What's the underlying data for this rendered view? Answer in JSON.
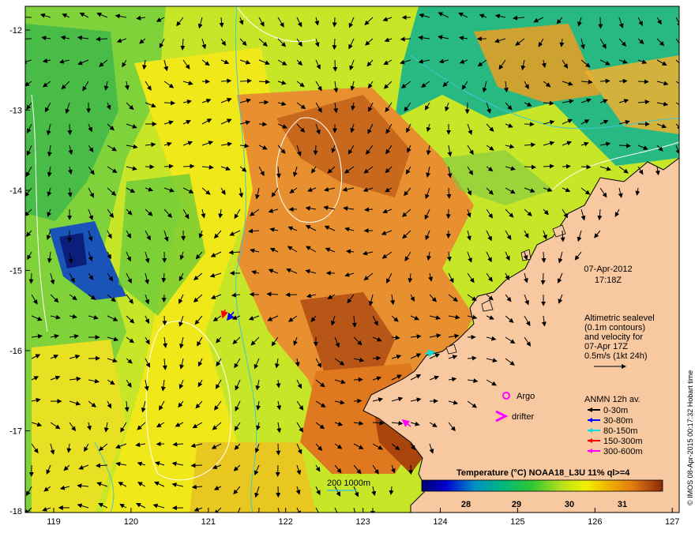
{
  "date_line": "07-Apr-2012",
  "time_line": "17:18Z",
  "altimetry_notes": [
    "Altimetric sealevel",
    "(0.1m contours)",
    "and velocity for",
    "07-Apr 17Z",
    "0.5m/s (1kt 24h)"
  ],
  "argo_label": "Argo",
  "drifter_label": "drifter",
  "anmn_title": "ANMN 12h av.",
  "anmn_legend": [
    {
      "label": "0-30m",
      "color": "#000000"
    },
    {
      "label": "30-80m",
      "color": "#0000ff"
    },
    {
      "label": "80-150m",
      "color": "#00e0e0"
    },
    {
      "label": "150-300m",
      "color": "#ff0000"
    },
    {
      "label": "300-600m",
      "color": "#ff00ff"
    }
  ],
  "bathy_label": "200  1000m",
  "colorbar_title": "Temperature (°C) NOAA18_L3U 11% ql>=4",
  "colorbar_ticks": [
    "28",
    "29",
    "30",
    "31"
  ],
  "credit": "© IMOS 08-Apr-2015 00:17:32 Hobart time",
  "x_ticks": [
    "119",
    "120",
    "121",
    "122",
    "123",
    "124",
    "125",
    "126",
    "127"
  ],
  "y_ticks": [
    "-12",
    "-13",
    "-14",
    "-15",
    "-16",
    "-17",
    "-18"
  ],
  "colors": {
    "land": "#f8c8a0",
    "argo": "#ff00ff",
    "drifter": "#ff00ff",
    "bathy": "#40c8d0",
    "contour": "#ffffff"
  }
}
